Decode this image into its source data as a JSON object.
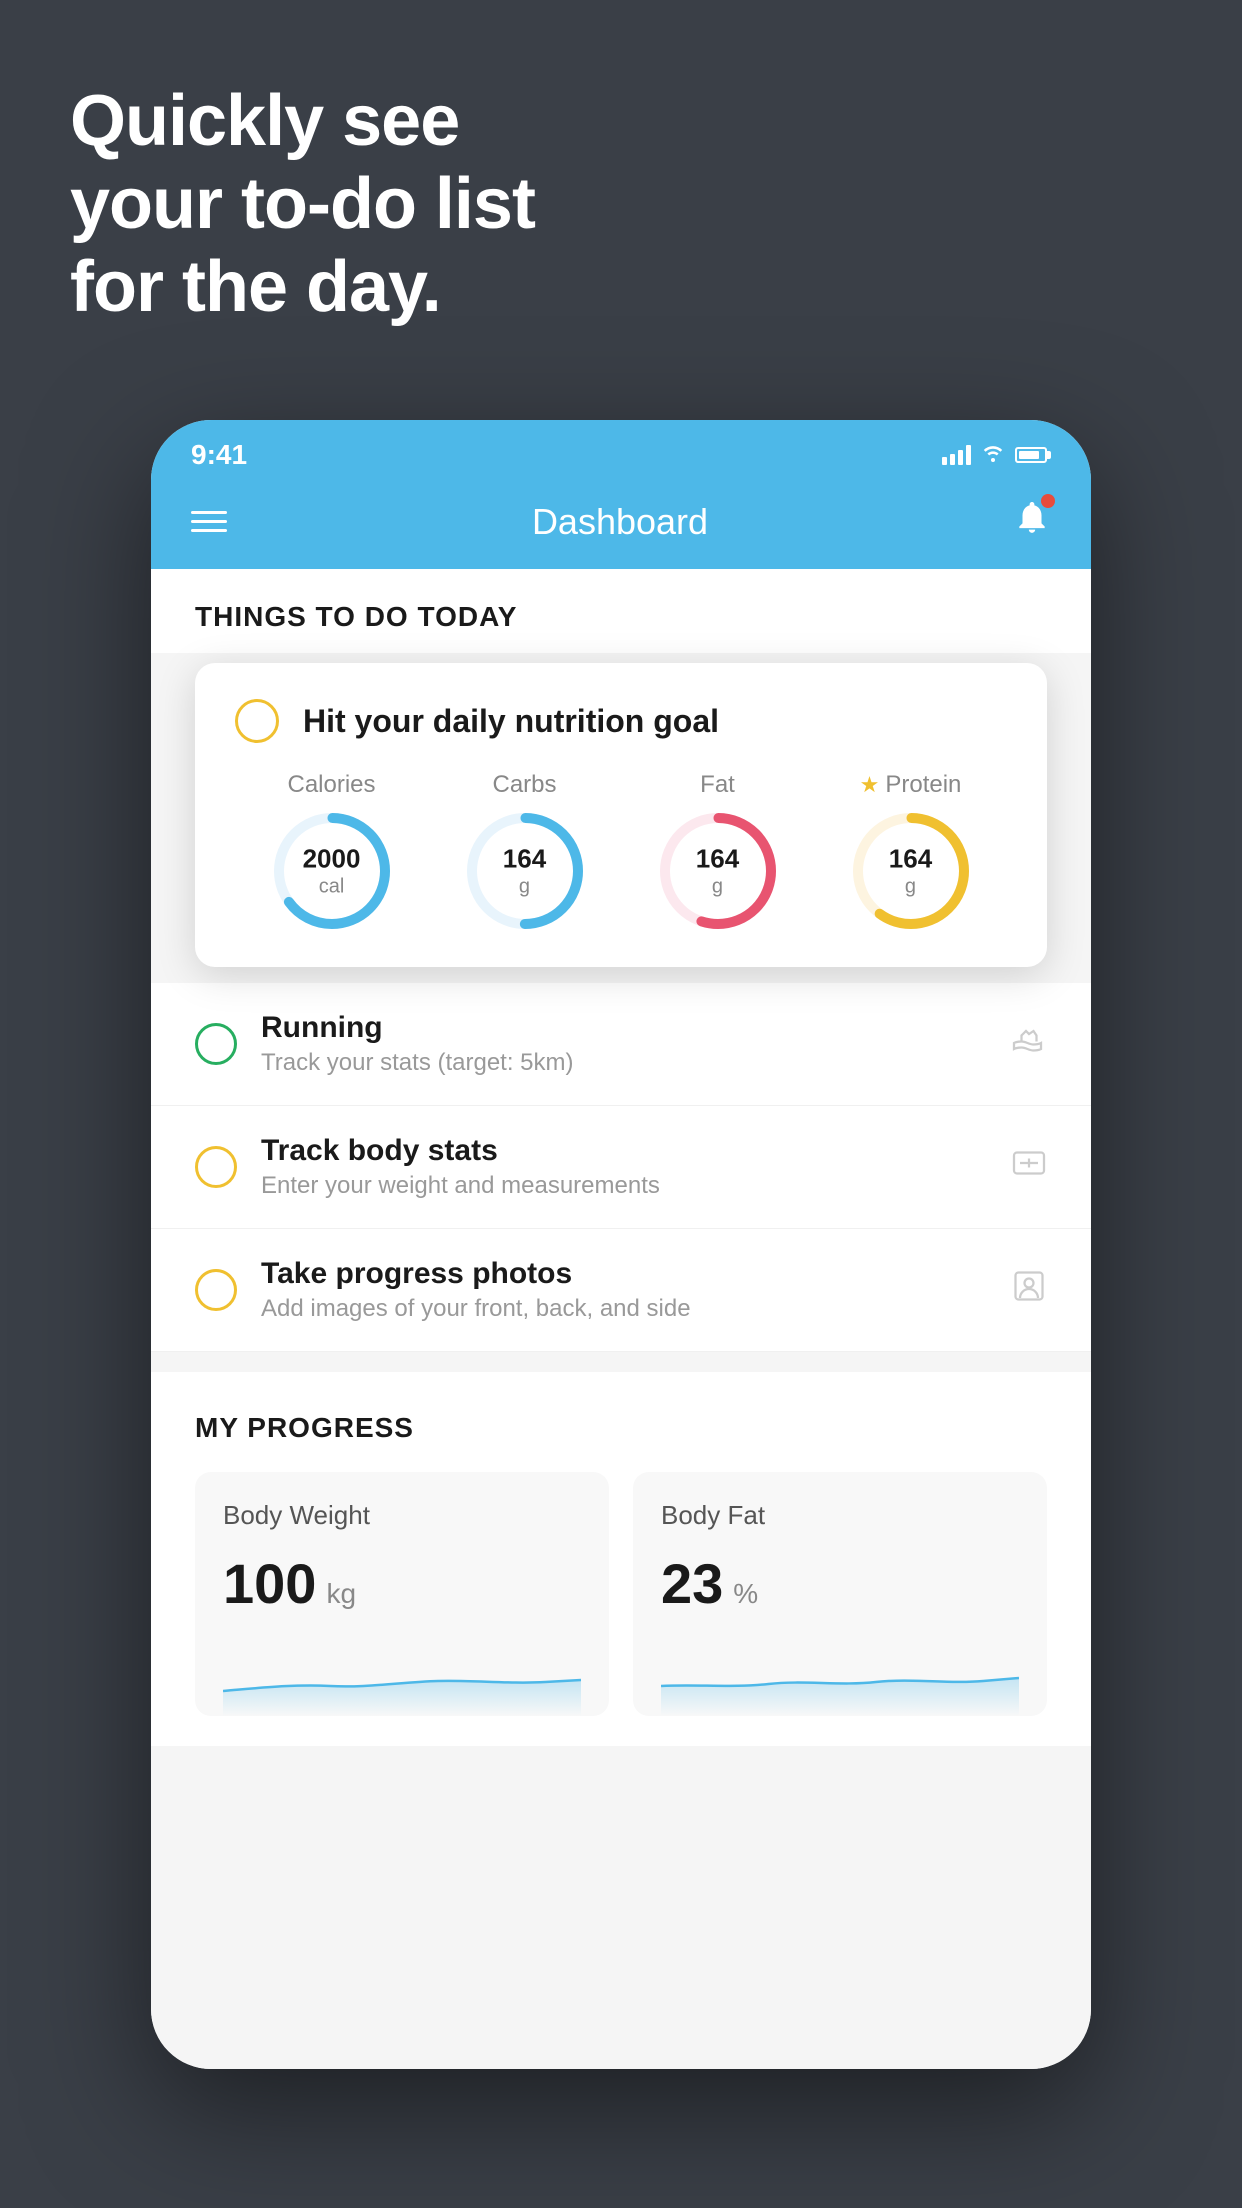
{
  "hero": {
    "line1": "Quickly see",
    "line2": "your to-do list",
    "line3": "for the day."
  },
  "statusBar": {
    "time": "9:41"
  },
  "navBar": {
    "title": "Dashboard"
  },
  "thingsToDo": {
    "header": "THINGS TO DO TODAY"
  },
  "nutritionCard": {
    "title": "Hit your daily nutrition goal",
    "items": [
      {
        "label": "Calories",
        "value": "2000",
        "unit": "cal",
        "color": "#4db8e8",
        "starred": false,
        "percent": 65
      },
      {
        "label": "Carbs",
        "value": "164",
        "unit": "g",
        "color": "#4db8e8",
        "starred": false,
        "percent": 50
      },
      {
        "label": "Fat",
        "value": "164",
        "unit": "g",
        "color": "#e85470",
        "starred": false,
        "percent": 55
      },
      {
        "label": "Protein",
        "value": "164",
        "unit": "g",
        "color": "#f0c030",
        "starred": true,
        "percent": 60
      }
    ]
  },
  "todoItems": [
    {
      "title": "Running",
      "subtitle": "Track your stats (target: 5km)",
      "circleColor": "green",
      "icon": "shoe"
    },
    {
      "title": "Track body stats",
      "subtitle": "Enter your weight and measurements",
      "circleColor": "yellow",
      "icon": "scale"
    },
    {
      "title": "Take progress photos",
      "subtitle": "Add images of your front, back, and side",
      "circleColor": "yellow",
      "icon": "person"
    }
  ],
  "progressSection": {
    "header": "MY PROGRESS",
    "cards": [
      {
        "title": "Body Weight",
        "value": "100",
        "unit": "kg"
      },
      {
        "title": "Body Fat",
        "value": "23",
        "unit": "%"
      }
    ]
  }
}
